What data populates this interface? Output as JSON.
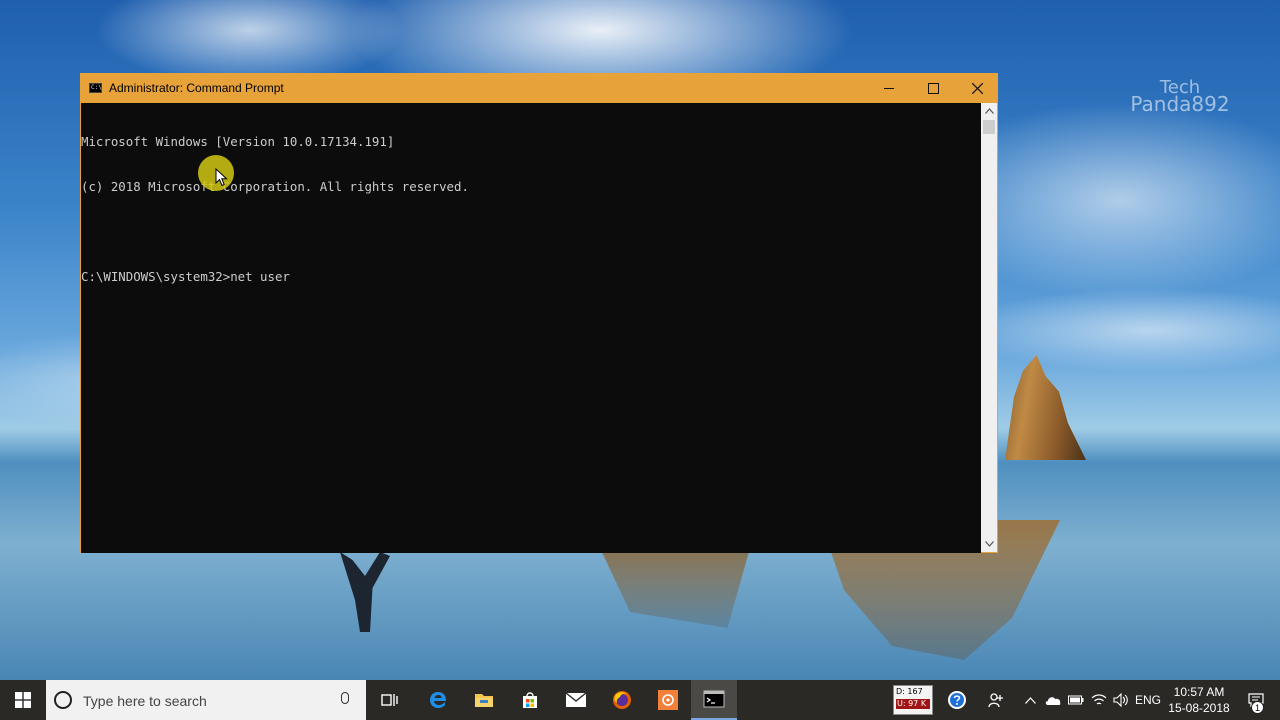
{
  "window": {
    "title": "Administrator: Command Prompt",
    "title_icon_glyph": "C:\\",
    "accent_color": "#e8a23a",
    "console_lines": [
      "Microsoft Windows [Version 10.0.17134.191]",
      "(c) 2018 Microsoft Corporation. All rights reserved.",
      "",
      "C:\\WINDOWS\\system32>net user"
    ],
    "controls": {
      "minimize": "minimize-icon",
      "maximize": "maximize-icon",
      "close": "close-icon"
    }
  },
  "desktop": {
    "watermark_line1": "Tech",
    "watermark_line2": "Panda892"
  },
  "taskbar": {
    "search_placeholder": "Type here to search",
    "apps": [
      "task-view-icon",
      "edge-icon",
      "file-explorer-icon",
      "store-icon",
      "mail-icon",
      "firefox-icon",
      "app-icon",
      "command-prompt-icon"
    ],
    "netmeter": {
      "down": "D: 167",
      "up": "U: 97 K"
    },
    "language": "ENG",
    "time": "10:57 AM",
    "date": "15-08-2018",
    "notification_count": "1"
  }
}
